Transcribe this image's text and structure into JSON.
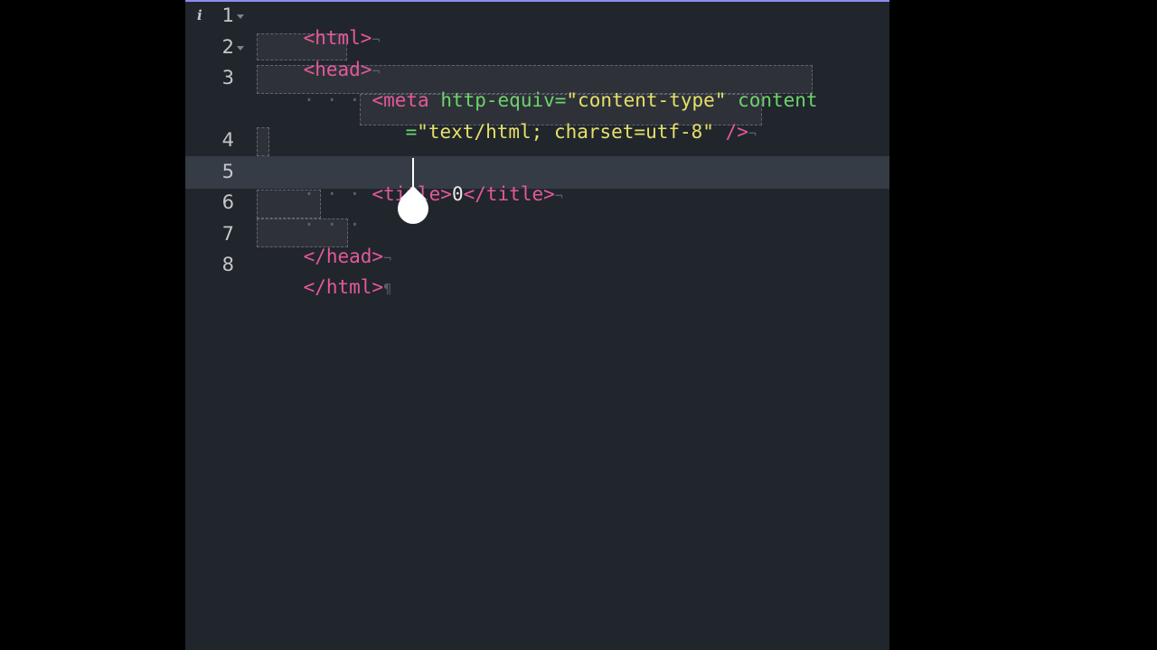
{
  "editor": {
    "line_numbers": [
      "1",
      "2",
      "3",
      "4",
      "5",
      "6",
      "7",
      "8"
    ],
    "info_glyph": "i",
    "eol_glyph": "¬",
    "eof_glyph": "¶",
    "lines": {
      "l1": {
        "indent": "",
        "tag": "<html>"
      },
      "l2": {
        "indent": "",
        "tag": "<head>"
      },
      "l3": {
        "indent": "· · · ",
        "tag_open": "<meta",
        "attr1": "http-equiv",
        "eq1": "=",
        "val1": "\"content-type\"",
        "attr2": "content",
        "cont_eq": "=",
        "val2": "\"text/html; charset=utf-8\"",
        "tag_close": "/>"
      },
      "l4": {
        "indent": ""
      },
      "l5": {
        "indent": "· · · ",
        "tag_open": "<title>",
        "text": "0",
        "tag_close": "</title>"
      },
      "l6": {
        "indent": "· · · "
      },
      "l7": {
        "tag": "</head>"
      },
      "l8": {
        "tag": "</html>"
      }
    },
    "current_line": "5",
    "cursor_after_text": "0"
  },
  "fab": {
    "icon": "chevron-down-icon"
  },
  "colors": {
    "tag": "#e4589a",
    "attribute": "#6ed36e",
    "string": "#e6e06a",
    "accent": "#8b8df0",
    "background": "#21262c"
  }
}
